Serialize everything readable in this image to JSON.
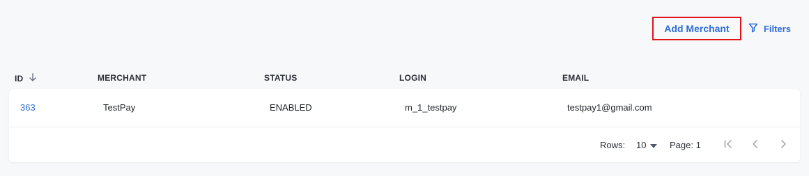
{
  "toolbar": {
    "add_label": "Add Merchant",
    "filters_label": "Filters"
  },
  "table": {
    "columns": [
      "ID",
      "MERCHANT",
      "STATUS",
      "LOGIN",
      "EMAIL"
    ],
    "sort": {
      "column": "ID",
      "direction": "descending"
    },
    "rows": [
      {
        "id": "363",
        "merchant": "TestPay",
        "status": "ENABLED",
        "login": "m_1_testpay",
        "email": "testpay1@gmail.com"
      }
    ]
  },
  "pagination": {
    "rows_label": "Rows:",
    "rows_value": "10",
    "page_label": "Page: 1"
  },
  "colors": {
    "accent": "#2f6fd6",
    "highlight_border": "#e1141b",
    "background": "#f7f8fa"
  }
}
